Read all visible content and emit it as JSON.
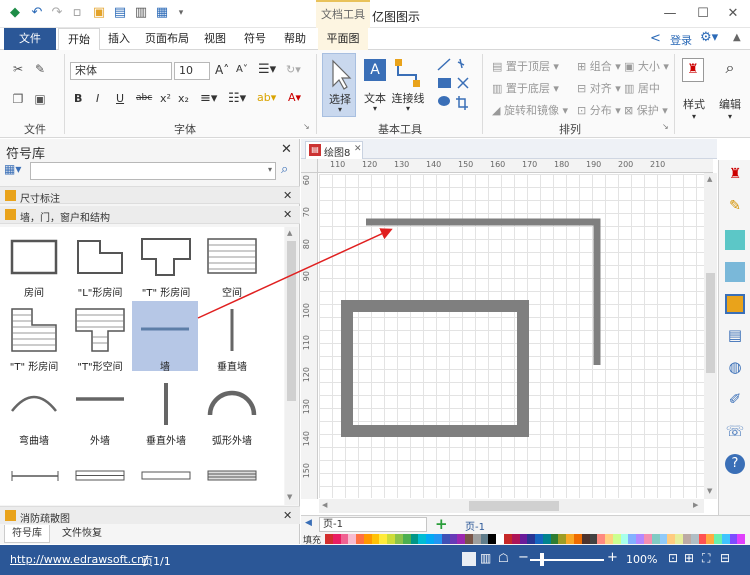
{
  "app": {
    "title": "亿图图示",
    "context_tab": "文档工具"
  },
  "quick_access": [
    "undo-icon",
    "redo-icon",
    "new-icon",
    "open-icon",
    "save-icon",
    "print-icon",
    "export-icon",
    "more-icon"
  ],
  "tabs": {
    "file": "文件",
    "items": [
      "开始",
      "插入",
      "页面布局",
      "视图",
      "符号",
      "帮助",
      "平面图"
    ],
    "active": "开始"
  },
  "account": {
    "login": "登录"
  },
  "ribbon": {
    "groups": {
      "file": "文件",
      "font": "字体",
      "basic_tools": "基本工具",
      "arrange": "排列"
    },
    "font_name": "宋体",
    "font_size": "10",
    "format_buttons": [
      "B",
      "I",
      "U",
      "abc",
      "x²",
      "x₂"
    ],
    "tools": {
      "select": "选择",
      "text": "文本",
      "connector": "连接线"
    },
    "arrange": {
      "bring_front": "置于顶层",
      "send_back": "置于底层",
      "rotate_mirror": "旋转和镜像",
      "group": "组合",
      "align": "对齐",
      "distribute": "分布",
      "size": "大小",
      "center": "居中",
      "protect": "保护"
    },
    "style": "样式",
    "edit": "编辑"
  },
  "library": {
    "title": "符号库",
    "sections": [
      {
        "title": "尺寸标注"
      },
      {
        "title": "墙，门，窗户和结构"
      }
    ],
    "shapes": [
      {
        "label": "房间"
      },
      {
        "label": "\"L\"形房间"
      },
      {
        "label": "\"T\" 形房间"
      },
      {
        "label": "空间"
      },
      {
        "label": "\"T\" 形房间"
      },
      {
        "label": "\"T\"形空间"
      },
      {
        "label": "墙"
      },
      {
        "label": "垂直墙"
      },
      {
        "label": "弯曲墙"
      },
      {
        "label": "外墙"
      },
      {
        "label": "垂直外墙"
      },
      {
        "label": "弧形外墙"
      }
    ],
    "bottom_section": "消防疏散图",
    "bottom_tabs": [
      "符号库",
      "文件恢复"
    ]
  },
  "document": {
    "tab": "绘图8"
  },
  "ruler": {
    "top": [
      "110",
      "120",
      "130",
      "140",
      "150",
      "160",
      "170",
      "180",
      "190",
      "200",
      "210"
    ],
    "left": [
      "60",
      "70",
      "80",
      "90",
      "100",
      "110",
      "120",
      "130",
      "140",
      "150"
    ]
  },
  "pages": {
    "current": "页-1",
    "tab": "页-1"
  },
  "fill_label": "填充",
  "colors": [
    "#d32f2f",
    "#e91e63",
    "#f06292",
    "#f8bbd0",
    "#ff7043",
    "#ff9800",
    "#ffc107",
    "#ffeb3b",
    "#cddc39",
    "#8bc34a",
    "#4caf50",
    "#009688",
    "#00bcd4",
    "#03a9f4",
    "#2196f3",
    "#3f51b5",
    "#673ab7",
    "#9c27b0",
    "#795548",
    "#9e9e9e",
    "#607d8b",
    "#000000",
    "#ffffff",
    "#c62828",
    "#ad1457",
    "#6a1b9a",
    "#283593",
    "#1565c0",
    "#00838f",
    "#2e7d32",
    "#9e9d24",
    "#f9a825",
    "#ef6c00",
    "#4e342e",
    "#424242",
    "#ff8a80",
    "#ffd180",
    "#ccff90",
    "#a7ffeb",
    "#82b1ff",
    "#b388ff",
    "#f48fb1",
    "#80cbc4",
    "#90caf9",
    "#ffcc80",
    "#e6ee9c",
    "#bcaaa4",
    "#b0bec5",
    "#ff5252",
    "#ffab40",
    "#69f0ae",
    "#40c4ff",
    "#7c4dff",
    "#e040fb"
  ],
  "status": {
    "url": "http://www.edrawsoft.cn/",
    "page": "页1/1",
    "zoom": "100%"
  },
  "accent": "#2b5797"
}
